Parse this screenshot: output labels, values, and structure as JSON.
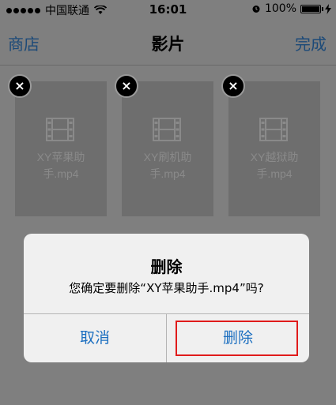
{
  "status_bar": {
    "carrier": "中国联通",
    "time": "16:01",
    "battery": "100%"
  },
  "nav": {
    "left": "商店",
    "title": "影片",
    "right": "完成"
  },
  "videos": [
    {
      "line1": "XY苹果助",
      "line2": "手.mp4"
    },
    {
      "line1": "XY刷机助",
      "line2": "手.mp4"
    },
    {
      "line1": "XY越狱助",
      "line2": "手.mp4"
    }
  ],
  "alert": {
    "title": "删除",
    "message": "您确定要删除“XY苹果助手.mp4”吗?",
    "cancel": "取消",
    "confirm": "删除"
  },
  "colors": {
    "accent": "#1c6fc0",
    "highlight": "#e01b1b"
  }
}
